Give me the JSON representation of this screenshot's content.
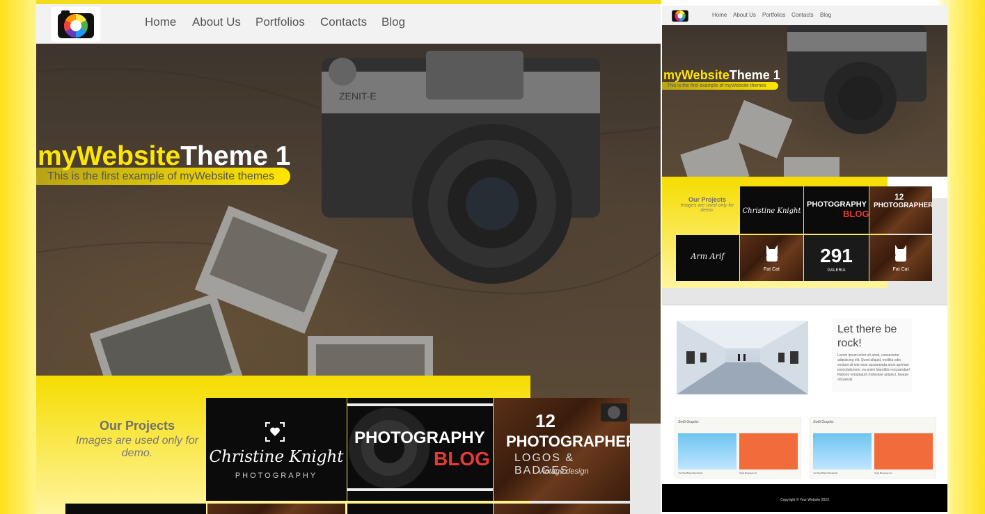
{
  "colors": {
    "accent": "#ffe600",
    "band": "#f5dc00",
    "text_gray": "#555555"
  },
  "nav": {
    "items": [
      "Home",
      "About Us",
      "Portfolios",
      "Contacts",
      "Blog"
    ]
  },
  "hero": {
    "title_yellow": "myWebsite",
    "title_white": "Theme 1",
    "subtitle": "This is the first example of myWebsite themes"
  },
  "projects": {
    "title": "Our Projects",
    "subtitle": "Images are used only for demo."
  },
  "tiles": {
    "christine_line1": "Christine Knight",
    "christine_line2": "PHOTOGRAPHY",
    "blog_line1": "PHOTOGRAPHY",
    "blog_line2": "BLOG",
    "logos_line1": "12",
    "logos_line2": "PHOTOGRAPHER",
    "logos_line3": "LOGOS & BADGES",
    "logos_line4": "Vintage design",
    "arif": "Arm Arif",
    "fatcat": "Fat Cat",
    "galeria_num": "291",
    "galeria": "GALERIA"
  },
  "rock": {
    "title": "Let there be rock!",
    "body": "Lorem ipsum dolor sit amet, consectetur adipisicing elit. Quod aliquid, mollitia odio veniam sit iste esse assumenda amet aperiam exercitationem, ea animi blanditiis recusandae! Ratione voluptatum molestiae adipisci, beatae obcaecati."
  },
  "cards": {
    "logo": "Swift Graphic",
    "left_caption": "YouTube/Brand Standards",
    "right_caption": "Soda Beverage Co."
  },
  "footer": {
    "text": "Copyright © Your Website 2023"
  }
}
